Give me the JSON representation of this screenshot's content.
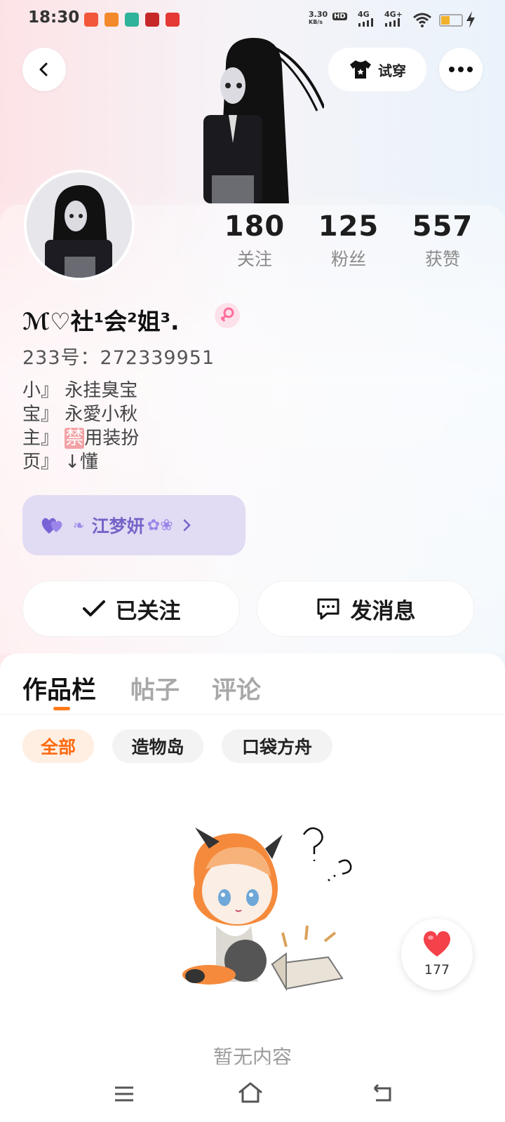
{
  "status_bar": {
    "time": "18:30",
    "net_speed_top": "3.30",
    "net_speed_unit": "KB/s",
    "hd_badge": "HD",
    "signal1": "4G",
    "signal2": "4G+"
  },
  "header": {
    "try_on_label": "试穿"
  },
  "profile": {
    "stats": [
      {
        "value": "180",
        "label": "关注"
      },
      {
        "value": "125",
        "label": "粉丝"
      },
      {
        "value": "557",
        "label": "获赞"
      }
    ],
    "nickname": "ℳ♡社¹会²姐³.",
    "uid": "233号：272339951",
    "bio_lines": [
      "小』 永挂臭宝",
      "宝』 永愛小秋",
      "主』 ",
      "页』 ↓懂"
    ],
    "bio_ban_word": "禁",
    "bio_line3_rest": "用装扮",
    "partner_name": "江梦妍",
    "follow_button": "已关注",
    "message_button": "发消息"
  },
  "tabs": [
    {
      "label": "作品栏",
      "active": true
    },
    {
      "label": "帖子",
      "active": false
    },
    {
      "label": "评论",
      "active": false
    }
  ],
  "filter_chips": [
    {
      "label": "全部",
      "active": true
    },
    {
      "label": "造物岛",
      "active": false
    },
    {
      "label": "口袋方舟",
      "active": false
    }
  ],
  "empty_state": {
    "text": "暂无内容"
  },
  "like_fab": {
    "count": "177"
  },
  "colors": {
    "accent": "#ff7a1a",
    "partner_bg": "#e1dbf3",
    "partner_text": "#7763c9"
  }
}
